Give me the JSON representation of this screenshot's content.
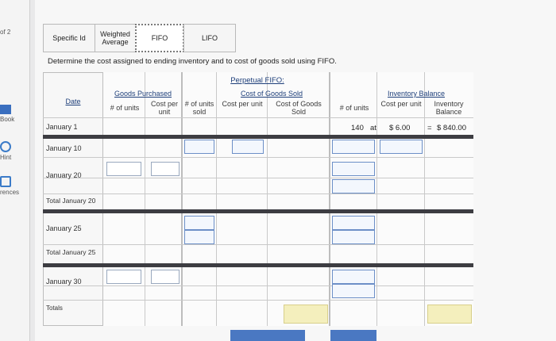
{
  "sidebar": {
    "page_indicator": "of 2",
    "labels": [
      "Book",
      "Hint",
      "rences"
    ]
  },
  "tabs": [
    {
      "label": "Specific Id",
      "active": false
    },
    {
      "label": "Weighted Average",
      "active": false
    },
    {
      "label": "FIFO",
      "active": true
    },
    {
      "label": "LIFO",
      "active": false
    }
  ],
  "instruction": "Determine the cost assigned to ending inventory and to cost of goods sold using FIFO.",
  "table": {
    "top_title": "Perpetual FIFO:",
    "date_header": "Date",
    "goods_purchased": {
      "title": "Goods Purchased",
      "cols": [
        "# of units",
        "Cost per unit"
      ]
    },
    "cogs": {
      "title": "Cost of Goods Sold",
      "cols": [
        "# of units sold",
        "Cost per unit",
        "Cost of Goods Sold"
      ]
    },
    "inventory": {
      "title": "Inventory Balance",
      "cols": [
        "# of units",
        "Cost per unit",
        "Inventory Balance"
      ]
    },
    "rows": [
      "January 1",
      "January 10",
      "January 20",
      "Total January 20",
      "January 25",
      "Total January 25",
      "January 30",
      "Totals"
    ],
    "january1": {
      "units": "140",
      "at": "at",
      "cost": "$ 6.00",
      "eq": "=",
      "balance": "$ 840.00"
    }
  },
  "colors": {
    "accent": "#3a6fbf",
    "separator": "#3d3d42",
    "highlight": "#f4efbd"
  }
}
